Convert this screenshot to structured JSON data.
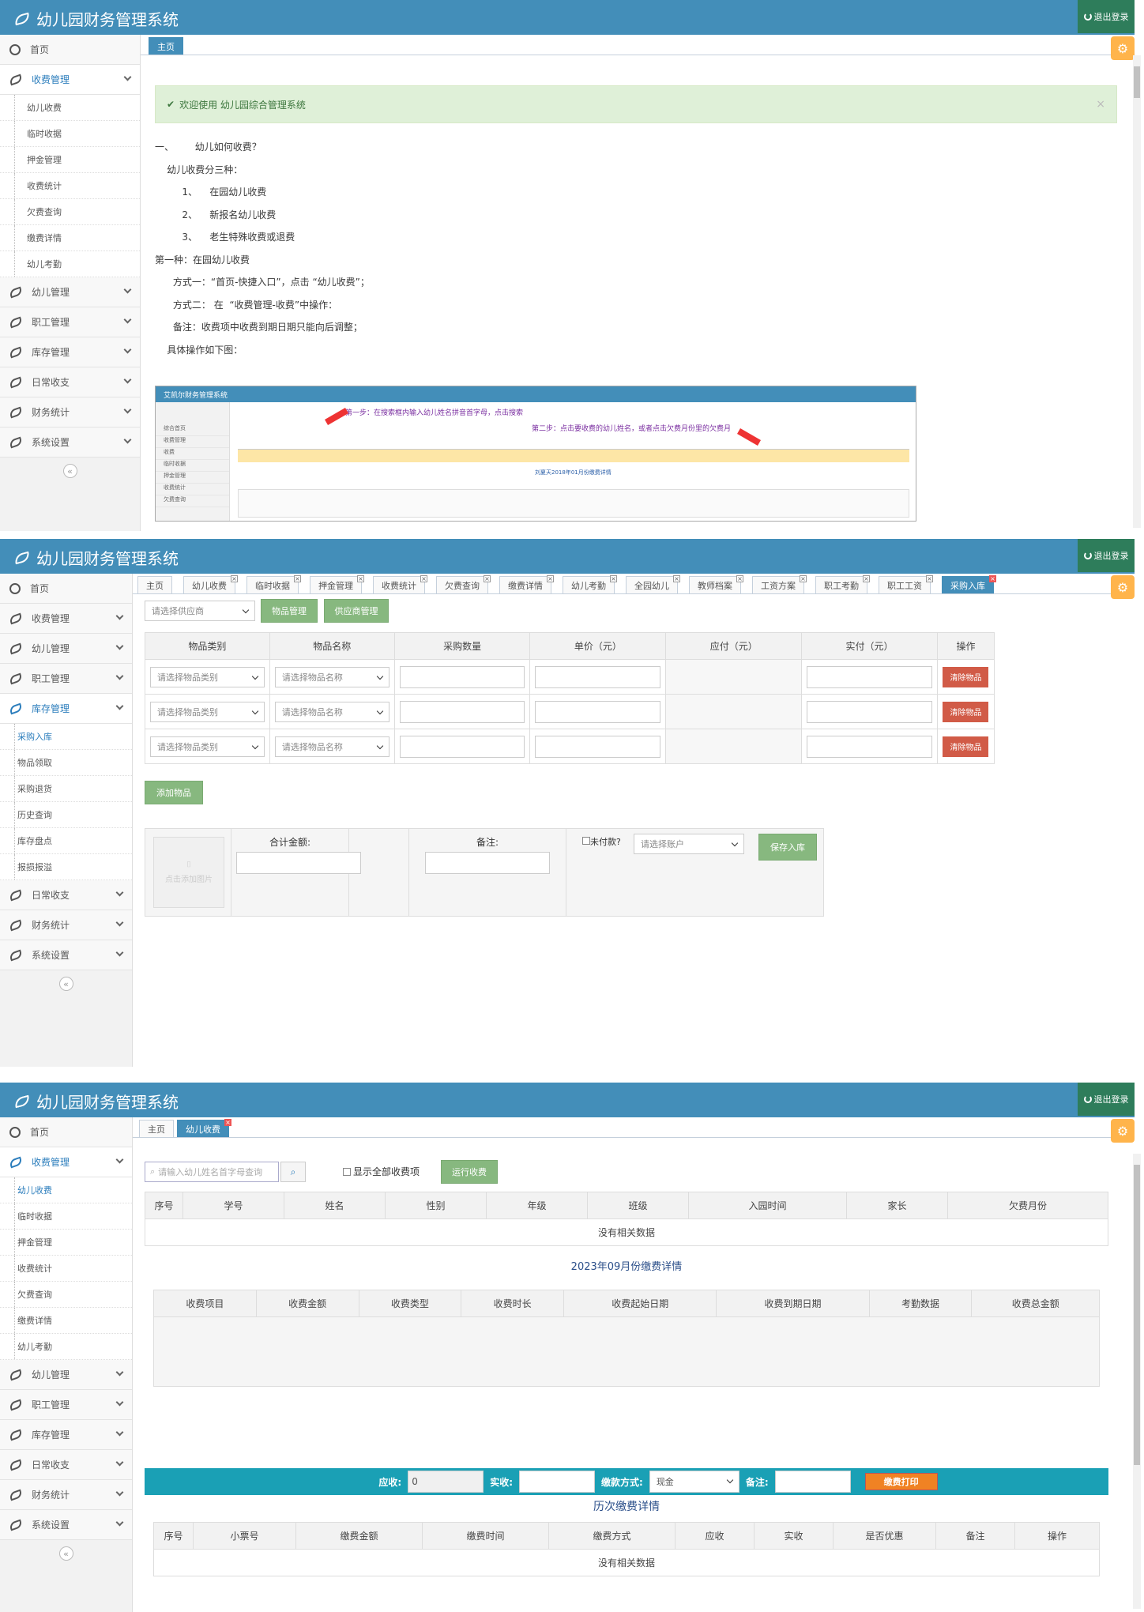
{
  "app_title": "幼儿园财务管理系统",
  "logout_label": "退出登录",
  "home": "首页",
  "collapse_icon": "«",
  "s1": {
    "nav": [
      {
        "label": "首页"
      },
      {
        "label": "收费管理"
      },
      {
        "label": "幼儿管理"
      },
      {
        "label": "职工管理"
      },
      {
        "label": "库存管理"
      },
      {
        "label": "日常收支"
      },
      {
        "label": "财务统计"
      },
      {
        "label": "系统设置"
      }
    ],
    "sub": [
      "幼儿收费",
      "临时收据",
      "押金管理",
      "收费统计",
      "欠费查询",
      "缴费详情",
      "幼儿考勤"
    ],
    "tabs": [
      "主页"
    ],
    "welcome": "欢迎使用 幼儿园综合管理系统",
    "guide": [
      "一、       幼儿如何收费？",
      "    幼儿收费分三种：",
      "         1、    在园幼儿收费",
      "         2、    新报名幼儿收费",
      "         3、    老生特殊收费或退费",
      "",
      "第一种：在园幼儿收费",
      "      方式一：“首页-快捷入口”，点击 “幼儿收费”；",
      "      方式二： 在  “收费管理-收费”中操作：",
      "      备注：收费项中收费到期日期只能向后调整；",
      "    具体操作如下图："
    ],
    "mini": {
      "title": "艾凯尔财务管理系统",
      "step1": "第一步：在搜索框内输入幼儿姓名拼音首字母，点击搜索",
      "step2": "第二步：点击要收费的幼儿姓名，或者点击欠费月份里的欠费月",
      "detail": "刘夏天2018年01月份缴费详情",
      "nav": [
        "综合首页",
        "收费管理",
        "收费",
        "临时收据",
        "押金管理",
        "收费统计",
        "欠费查询"
      ]
    }
  },
  "s2": {
    "nav_top": [
      "首页",
      "收费管理",
      "幼儿管理",
      "职工管理",
      "库存管理"
    ],
    "sub": [
      "采购入库",
      "物品领取",
      "采购退货",
      "历史查询",
      "库存盘点",
      "报损报溢"
    ],
    "nav_bottom": [
      "日常收支",
      "财务统计",
      "系统设置"
    ],
    "tabs": [
      "主页",
      "幼儿收费",
      "临时收据",
      "押金管理",
      "收费统计",
      "欠费查询",
      "缴费详情",
      "幼儿考勤",
      "全园幼儿",
      "教师档案",
      "工资方案",
      "职工考勤",
      "职工工资",
      "采购入库"
    ],
    "supplier_placeholder": "请选择供应商",
    "btn_goods": "物品管理",
    "btn_supplier": "供应商管理",
    "headers": [
      "物品类别",
      "物品名称",
      "采购数量",
      "单价（元）",
      "应付（元）",
      "实付（元）",
      "操作"
    ],
    "row_cat": "请选择物品类别",
    "row_name": "请选择物品名称",
    "btn_clear": "清除物品",
    "btn_add": "添加物品",
    "img_hint": "点击添加图片",
    "total_label": "合计金额:",
    "remark_label": "备注:",
    "unpaid_label": "未付款?",
    "account_placeholder": "请选择账户",
    "btn_save": "保存入库"
  },
  "s3": {
    "nav_top": [
      "首页",
      "收费管理"
    ],
    "sub": [
      "幼儿收费",
      "临时收据",
      "押金管理",
      "收费统计",
      "欠费查询",
      "缴费详情",
      "幼儿考勤"
    ],
    "nav_bottom": [
      "幼儿管理",
      "职工管理",
      "库存管理",
      "日常收支",
      "财务统计",
      "系统设置"
    ],
    "tabs": [
      "主页",
      "幼儿收费"
    ],
    "search_placeholder": "请输入幼儿姓名首字母查询",
    "show_all": "显示全部收费项",
    "btn_run": "运行收费",
    "headers1": [
      "序号",
      "学号",
      "姓名",
      "性别",
      "年级",
      "班级",
      "入园时间",
      "家长",
      "欠费月份"
    ],
    "empty": "没有相关数据",
    "detail_title": "2023年09月份缴费详情",
    "headers2": [
      "收费项目",
      "收费金额",
      "收费类型",
      "收费时长",
      "收费起始日期",
      "收费到期日期",
      "考勤数据",
      "收费总金额"
    ],
    "due_label": "应收:",
    "due_value": "0",
    "paid_label": "实收:",
    "method_label": "缴款方式:",
    "method_value": "现金",
    "note_label": "备注:",
    "btn_print": "缴费打印",
    "history_title": "历次缴费详情",
    "headers3": [
      "序号",
      "小票号",
      "缴费金额",
      "缴费时间",
      "缴费方式",
      "应收",
      "实收",
      "是否优惠",
      "备注",
      "操作"
    ]
  }
}
